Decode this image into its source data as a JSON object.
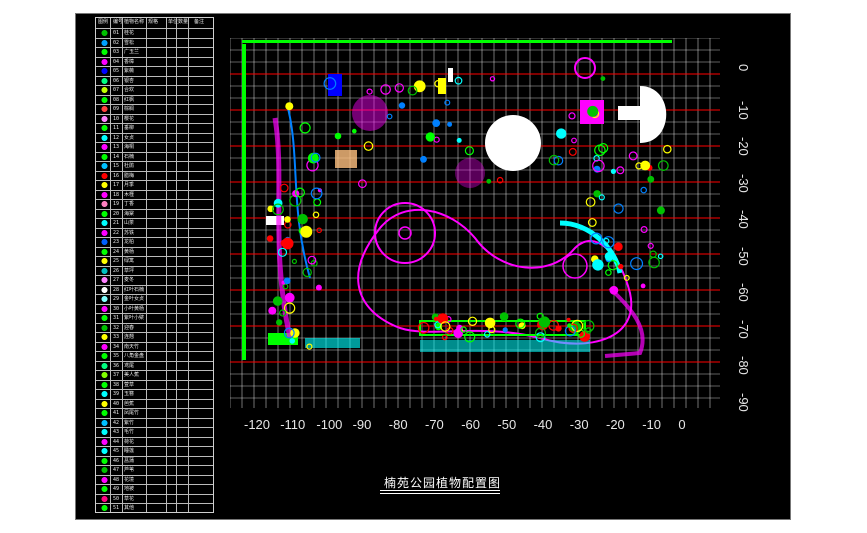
{
  "title": "楠苑公园植物配置图",
  "legend": {
    "header": [
      "图例",
      "编号",
      "植物名称",
      "规格",
      "单位",
      "数量",
      "备注"
    ],
    "rows": [
      {
        "num": "01",
        "name": "桂花",
        "color": "#00c000"
      },
      {
        "num": "02",
        "name": "雪松",
        "color": "#00a0ff"
      },
      {
        "num": "03",
        "name": "广玉兰",
        "color": "#00ff00"
      },
      {
        "num": "04",
        "name": "香樟",
        "color": "#ff00ff"
      },
      {
        "num": "05",
        "name": "紫薇",
        "color": "#0000ff"
      },
      {
        "num": "06",
        "name": "银杏",
        "color": "#00ff80"
      },
      {
        "num": "07",
        "name": "合欢",
        "color": "#c0ff00"
      },
      {
        "num": "08",
        "name": "红枫",
        "color": "#00ff00"
      },
      {
        "num": "09",
        "name": "棕榈",
        "color": "#ff4040"
      },
      {
        "num": "10",
        "name": "樱花",
        "color": "#ff80ff"
      },
      {
        "num": "11",
        "name": "垂柳",
        "color": "#00ff00"
      },
      {
        "num": "12",
        "name": "女贞",
        "color": "#00ffff"
      },
      {
        "num": "13",
        "name": "海桐",
        "color": "#ff00ff"
      },
      {
        "num": "14",
        "name": "石楠",
        "color": "#00ff00"
      },
      {
        "num": "15",
        "name": "杜鹃",
        "color": "#00c0ff"
      },
      {
        "num": "16",
        "name": "腊梅",
        "color": "#ff0000"
      },
      {
        "num": "17",
        "name": "月季",
        "color": "#ffff00"
      },
      {
        "num": "18",
        "name": "木槿",
        "color": "#ff00ff"
      },
      {
        "num": "19",
        "name": "丁香",
        "color": "#ff80c0"
      },
      {
        "num": "20",
        "name": "海棠",
        "color": "#00ff00"
      },
      {
        "num": "21",
        "name": "山茶",
        "color": "#00ffff"
      },
      {
        "num": "22",
        "name": "苏铁",
        "color": "#ff00ff"
      },
      {
        "num": "23",
        "name": "龙柏",
        "color": "#0060ff"
      },
      {
        "num": "24",
        "name": "黄杨",
        "color": "#00ff00"
      },
      {
        "num": "25",
        "name": "绿篱",
        "color": "#ffff00"
      },
      {
        "num": "26",
        "name": "草坪",
        "color": "#00c0c0"
      },
      {
        "num": "27",
        "name": "麦冬",
        "color": "#ff80ff"
      },
      {
        "num": "28",
        "name": "红叶石楠",
        "color": "#ffffff"
      },
      {
        "num": "29",
        "name": "金叶女贞",
        "color": "#80ffff"
      },
      {
        "num": "30",
        "name": "小叶黄杨",
        "color": "#ff00ff"
      },
      {
        "num": "31",
        "name": "紫叶小檗",
        "color": "#00ff00"
      },
      {
        "num": "32",
        "name": "迎春",
        "color": "#00c000"
      },
      {
        "num": "33",
        "name": "连翘",
        "color": "#ffff00"
      },
      {
        "num": "34",
        "name": "南天竹",
        "color": "#ff00ff"
      },
      {
        "num": "35",
        "name": "八角金盘",
        "color": "#00ff00"
      },
      {
        "num": "36",
        "name": "鸢尾",
        "color": "#00ff80"
      },
      {
        "num": "37",
        "name": "美人蕉",
        "color": "#80ff00"
      },
      {
        "num": "38",
        "name": "萱草",
        "color": "#00ff00"
      },
      {
        "num": "39",
        "name": "玉簪",
        "color": "#00ffff"
      },
      {
        "num": "40",
        "name": "芭蕉",
        "color": "#ffff00"
      },
      {
        "num": "41",
        "name": "凤尾竹",
        "color": "#00ff00"
      },
      {
        "num": "42",
        "name": "紫竹",
        "color": "#00c0ff"
      },
      {
        "num": "43",
        "name": "毛竹",
        "color": "#00ffff"
      },
      {
        "num": "44",
        "name": "荷花",
        "color": "#ff00ff"
      },
      {
        "num": "45",
        "name": "睡莲",
        "color": "#00ffff"
      },
      {
        "num": "46",
        "name": "菖蒲",
        "color": "#00ff00"
      },
      {
        "num": "47",
        "name": "芦苇",
        "color": "#00c000"
      },
      {
        "num": "48",
        "name": "花境",
        "color": "#ff00ff"
      },
      {
        "num": "49",
        "name": "地被",
        "color": "#00ff00"
      },
      {
        "num": "50",
        "name": "草花",
        "color": "#ff0080"
      },
      {
        "num": "51",
        "name": "其他",
        "color": "#00ff00"
      }
    ]
  },
  "axes": {
    "x_ticks": [
      "-120",
      "-110",
      "-100",
      "-90",
      "-80",
      "-70",
      "-60",
      "-50",
      "-40",
      "-30",
      "-20",
      "-10",
      "0"
    ],
    "y_ticks": [
      "0",
      "-10",
      "-20",
      "-30",
      "-40",
      "-50",
      "-60",
      "-70",
      "-80",
      "-90"
    ]
  },
  "colors": {
    "background": "#000000",
    "grid": "#ffffff",
    "redline": "#ff0000",
    "road": "#ff00ff",
    "tree": "#00ff00",
    "water": "#00ffff",
    "building": "#ffffff",
    "accent_block": "#ff00ff"
  }
}
